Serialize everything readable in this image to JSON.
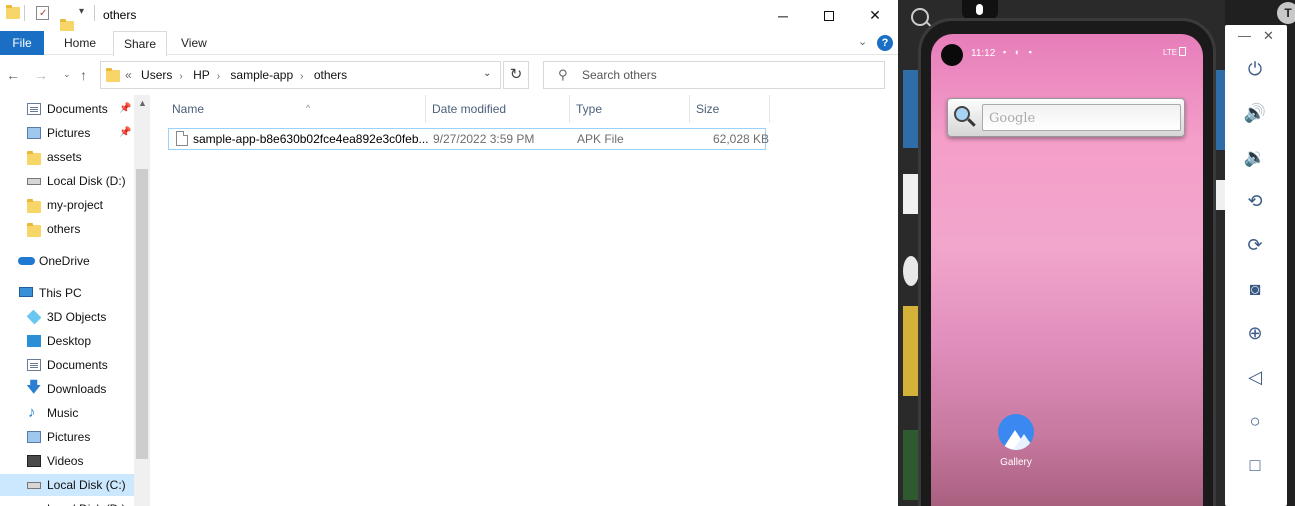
{
  "explorer": {
    "title": "others",
    "ribbon_tabs": [
      "File",
      "Home",
      "Share",
      "View"
    ],
    "breadcrumb_prefix": "«",
    "breadcrumb": [
      "Users",
      "HP",
      "sample-app",
      "others"
    ],
    "search_placeholder": "Search others",
    "nav_pane": {
      "quick_access": [
        {
          "label": "Documents",
          "pinned": true
        },
        {
          "label": "Pictures",
          "pinned": true
        },
        {
          "label": "assets"
        },
        {
          "label": "Local Disk (D:)"
        },
        {
          "label": "my-project"
        },
        {
          "label": "others"
        }
      ],
      "onedrive": "OneDrive",
      "this_pc": "This PC",
      "this_pc_items": [
        "3D Objects",
        "Desktop",
        "Documents",
        "Downloads",
        "Music",
        "Pictures",
        "Videos",
        "Local Disk (C:)",
        "Local Disk (D:)"
      ]
    },
    "columns": [
      "Name",
      "Date modified",
      "Type",
      "Size"
    ],
    "files": [
      {
        "name": "sample-app-b8e630b02fce4ea892e3c0feb...",
        "date": "9/27/2022 3:59 PM",
        "type": "APK File",
        "size": "62,028 KB"
      }
    ]
  },
  "emulator": {
    "status_time": "11:12",
    "status_network": "LTE",
    "search_widget_placeholder": "Google",
    "app_icons": [
      {
        "label": "Gallery"
      }
    ],
    "toolbar_icons": [
      "power-icon",
      "volume-up-icon",
      "volume-down-icon",
      "rotate-left-icon",
      "rotate-right-icon",
      "camera-icon",
      "zoom-icon",
      "back-icon",
      "home-icon",
      "overview-icon"
    ],
    "avatar_letter": "T"
  },
  "colors": {
    "file_tab": "#1a6fc4",
    "selection": "#cce8ff",
    "wallpaper_top": "#e67dba",
    "wallpaper_bottom": "#a9607f"
  }
}
